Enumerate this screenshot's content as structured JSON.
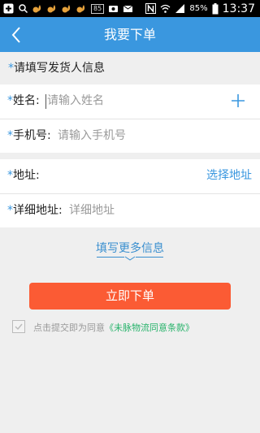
{
  "status_bar": {
    "time": "13:37",
    "battery": "85%",
    "left_box": "85",
    "colors": {
      "bg": "#000000",
      "fg": "#ffffff"
    }
  },
  "nav": {
    "title": "我要下单",
    "back_icon": "chevron-left-icon",
    "color": "#3a97df"
  },
  "sender_section": {
    "required_mark": "*",
    "title": "请填写发货人信息"
  },
  "fields": {
    "name": {
      "label": "姓名:",
      "placeholder": "请输入姓名",
      "action_icon": "plus-icon"
    },
    "phone": {
      "label": "手机号:",
      "placeholder": "请输入手机号"
    },
    "address": {
      "label": "地址:",
      "action": "选择地址"
    },
    "detail_address": {
      "label": "详细地址:",
      "placeholder": "详细地址"
    }
  },
  "more_info": "填写更多信息",
  "submit": {
    "label": "立即下单",
    "color": "#fb5b34"
  },
  "agreement": {
    "prefix": "点击提交即为同意",
    "link": "《未脉物流同意条款》",
    "link_color": "#28b36b"
  }
}
